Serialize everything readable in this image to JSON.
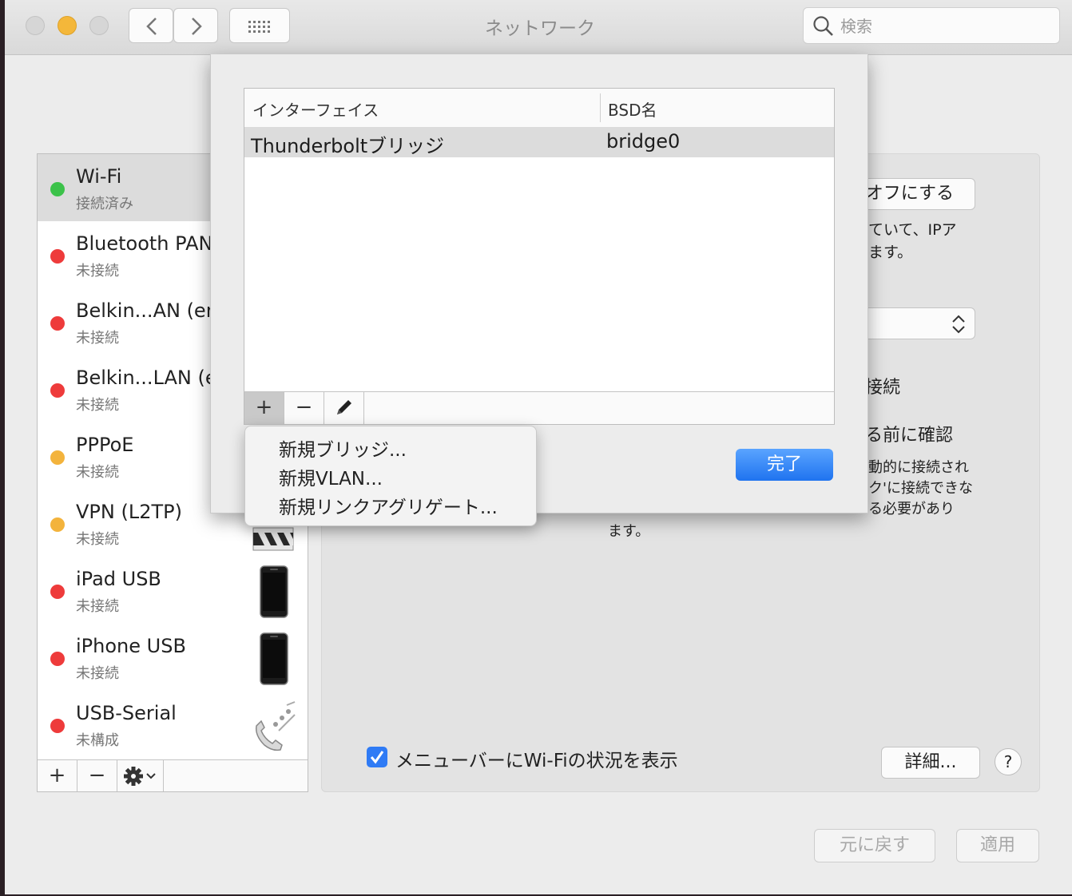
{
  "window": {
    "title": "ネットワーク",
    "search_placeholder": "検索"
  },
  "colors": {
    "status_connected": "#3cc24a",
    "status_disconnected": "#ee3b3b",
    "status_inactive": "#f3b33c",
    "accent": "#1f73ef"
  },
  "sidebar": {
    "services": [
      {
        "name": "Wi-Fi",
        "status": "接続済み",
        "color": "green"
      },
      {
        "name": "Bluetooth PAN",
        "status": "未接続",
        "color": "red"
      },
      {
        "name": "Belkin...AN (en",
        "status": "未接続",
        "color": "red"
      },
      {
        "name": "Belkin...LAN (e",
        "status": "未接続",
        "color": "red"
      },
      {
        "name": "PPPoE",
        "status": "未接続",
        "color": "yellow"
      },
      {
        "name": "VPN (L2TP)",
        "status": "未接続",
        "color": "yellow",
        "icon": "vpn-icon"
      },
      {
        "name": "iPad USB",
        "status": "未接続",
        "color": "red",
        "icon": "ipad-icon"
      },
      {
        "name": "iPhone USB",
        "status": "未接続",
        "color": "red",
        "icon": "iphone-icon"
      },
      {
        "name": "USB-Serial",
        "status": "未構成",
        "color": "red",
        "icon": "phone-modem-icon"
      }
    ],
    "toolbar": {
      "add": "+",
      "remove": "−"
    }
  },
  "main": {
    "turn_off_fragment": "オフにする",
    "info_line1": "ていて、IPア",
    "info_line2": "ます。",
    "auto_join_fragment": "接続",
    "ask_fragment": "る前に確認",
    "known_line1": "動的に接続され",
    "known_line2": "ク'に接続できな",
    "known_line3": "る必要があり",
    "known_line4": "ます。",
    "show_wifi_status_label": "メニューバーにWi-Fiの状況を表示",
    "advanced_button": "詳細...",
    "help_button": "?"
  },
  "sheet": {
    "columns": {
      "interface": "インターフェイス",
      "bsd": "BSD名"
    },
    "rows": [
      {
        "interface": "Thunderboltブリッジ",
        "bsd": "bridge0"
      }
    ],
    "toolbar": {
      "add": "+",
      "remove": "−"
    },
    "done_button": "完了"
  },
  "dropdown_menu": {
    "items": [
      "新規ブリッジ...",
      "新規VLAN...",
      "新規リンクアグリゲート..."
    ]
  },
  "footer": {
    "revert_button": "元に戻す",
    "apply_button": "適用"
  }
}
